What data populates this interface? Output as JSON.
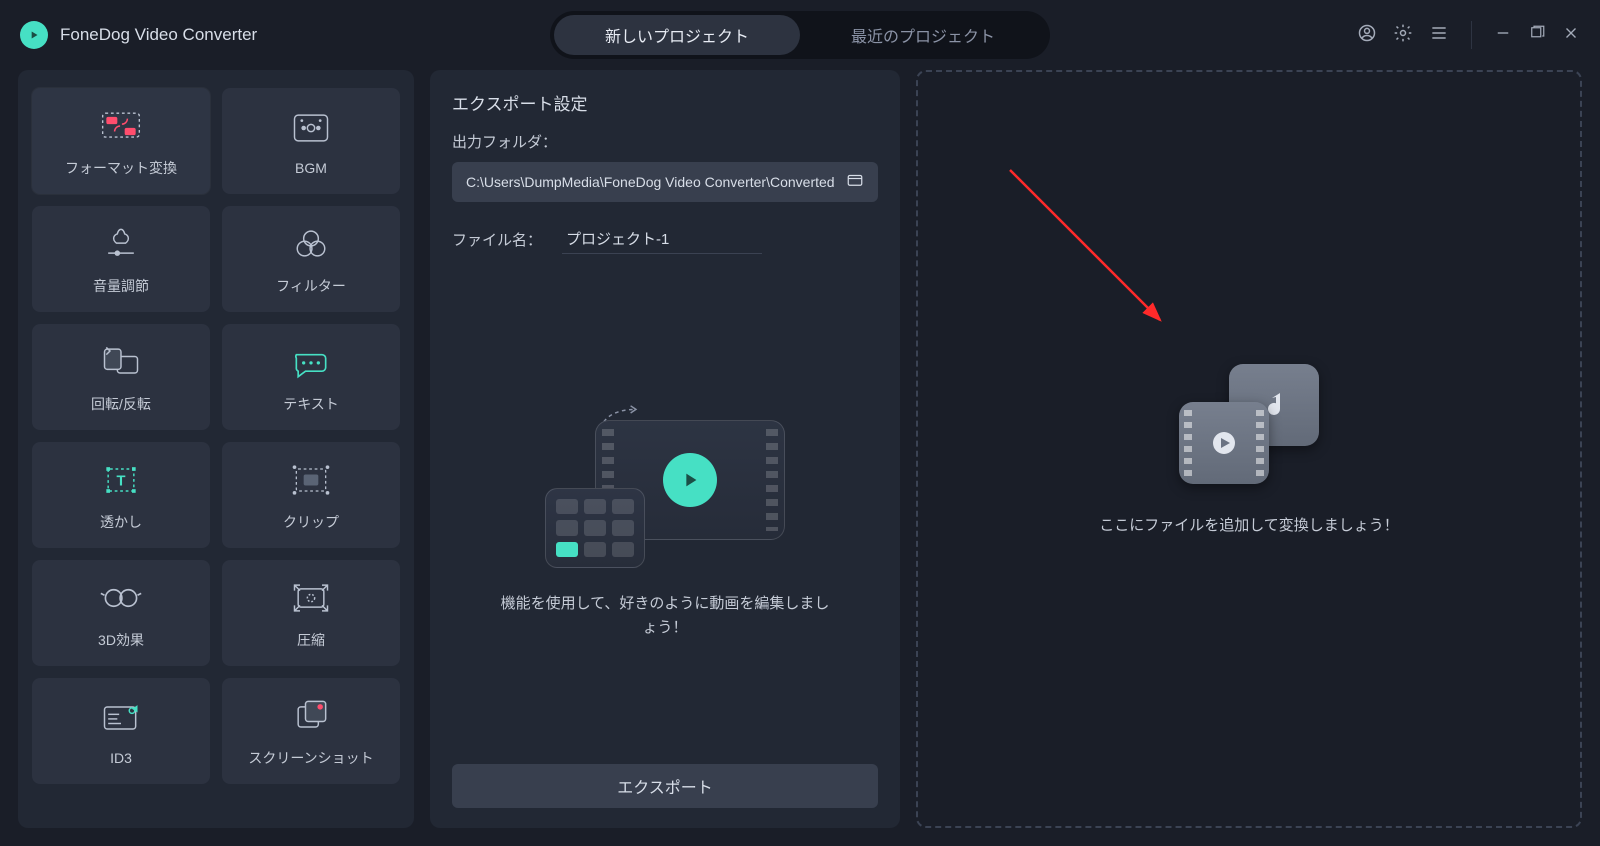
{
  "app": {
    "title": "FoneDog Video Converter"
  },
  "tabs": {
    "new": "新しいプロジェクト",
    "recent": "最近のプロジェクト"
  },
  "sidebar": {
    "items": [
      {
        "id": "format-convert",
        "label": "フォーマット変換"
      },
      {
        "id": "bgm",
        "label": "BGM"
      },
      {
        "id": "volume",
        "label": "音量調節"
      },
      {
        "id": "filter",
        "label": "フィルター"
      },
      {
        "id": "rotate",
        "label": "回転/反転"
      },
      {
        "id": "text",
        "label": "テキスト"
      },
      {
        "id": "watermark",
        "label": "透かし"
      },
      {
        "id": "clip",
        "label": "クリップ"
      },
      {
        "id": "3d",
        "label": "3D効果"
      },
      {
        "id": "compress",
        "label": "圧縮"
      },
      {
        "id": "id3",
        "label": "ID3"
      },
      {
        "id": "screenshot",
        "label": "スクリーンショット"
      }
    ]
  },
  "export": {
    "heading": "エクスポート設定",
    "folder_label": "出力フォルダ：",
    "folder_path": "C:\\Users\\DumpMedia\\FoneDog Video Converter\\Converted",
    "filename_label": "ファイル名：",
    "filename_value": "プロジェクト-1",
    "caption": "機能を使用して、好きのように動画を編集しましょう！",
    "button": "エクスポート"
  },
  "dropzone": {
    "caption": "ここにファイルを追加して変換しましょう！"
  }
}
